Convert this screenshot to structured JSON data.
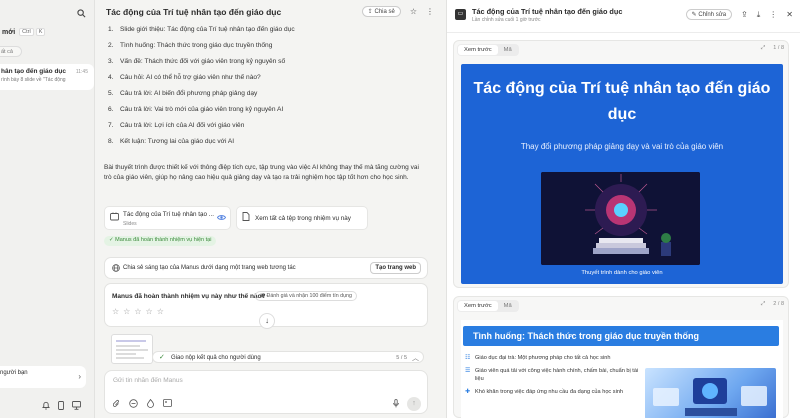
{
  "sidebar": {
    "new_label": "mới",
    "new_shortcut_1": "Ctrl",
    "new_shortcut_2": "K",
    "filter_chip": "ất cả",
    "task": {
      "title": "hân tạo đến giáo dục",
      "time": "11:45",
      "subtitle": "rình bày 8 slide về \"Tác động"
    },
    "share_prompt": "người bạn"
  },
  "chat": {
    "title": "Tác động của Trí tuệ nhân tạo đến giáo dục",
    "share_label": "Chia sẻ",
    "outline": [
      {
        "n": "1.",
        "text": "Slide giới thiệu: Tác động của Trí tuệ nhân tạo đến giáo dục"
      },
      {
        "n": "2.",
        "text": "Tình huống: Thách thức trong giáo dục truyền thống"
      },
      {
        "n": "3.",
        "text": "Vấn đề: Thách thức đối với giáo viên trong kỷ nguyên số"
      },
      {
        "n": "4.",
        "text": "Câu hỏi: AI có thể hỗ trợ giáo viên như thế nào?"
      },
      {
        "n": "5.",
        "text": "Câu trả lời: AI biến đổi phương pháp giảng dạy"
      },
      {
        "n": "6.",
        "text": "Câu trả lời: Vai trò mới của giáo viên trong kỷ nguyên AI"
      },
      {
        "n": "7.",
        "text": "Câu trả lời: Lợi ích của AI đối với giáo viên"
      },
      {
        "n": "8.",
        "text": "Kết luận: Tương lai của giáo dục với AI"
      }
    ],
    "summary": "Bài thuyết trình được thiết kế với thông điệp tích cực, tập trung vào việc AI không thay thế mà tăng cường vai trò của giáo viên, giúp họ nâng cao hiệu quả giảng dạy và tạo ra trải nghiệm học tập tốt hơn cho học sinh.",
    "attachment": {
      "title": "Tác động của Trí tuệ nhân tạo ...",
      "type": "Slides"
    },
    "view_all_files": "Xem tất cả tệp trong nhiệm vụ này",
    "done_badge": "Manus đã hoàn thành nhiệm vụ hiện tại",
    "share_manus": {
      "text": "Chia sẻ sáng tạo của Manus dưới dạng một trang web tương tác",
      "button": "Tạo trang web"
    },
    "rating": {
      "question": "Manus đã hoàn thành nhiệm vụ này như thế nào?",
      "badge": "Đánh giá và nhận 100 điểm tín dụng",
      "stars": "☆☆☆☆☆"
    },
    "progress": {
      "text": "Giao nộp kết quả cho người dùng",
      "count": "5 / 5"
    },
    "input": {
      "placeholder": "Gửi tin nhắn đến Manus",
      "value": ""
    }
  },
  "preview": {
    "title": "Tác động của Trí tuệ nhân tạo đến giáo dục",
    "subtitle": "Lần chỉnh sửa cuối 1 giờ trước",
    "edit_label": "Chỉnh sửa",
    "slides": [
      {
        "tab_preview": "Xem trước",
        "tab_code": "Mã",
        "counter": "1 / 8",
        "title": "Tác động của Trí tuệ nhân tạo đến giáo dục",
        "subtitle": "Thay đổi phương pháp giảng dạy và vai trò của giáo viên",
        "caption": "Thuyết trình dành cho giáo viên"
      },
      {
        "tab_preview": "Xem trước",
        "tab_code": "Mã",
        "counter": "2 / 8",
        "title": "Tình huống: Thách thức trong giáo dục truyền thống",
        "bullets": [
          "Giáo dục đại trà: Một phương pháp cho tất cả học sinh",
          "Giáo viên quá tải với công việc hành chính, chấm bài, chuẩn bị tài liệu",
          "Khó khăn trong việc đáp ứng nhu cầu đa dạng của học sinh"
        ]
      }
    ]
  },
  "colors": {
    "slide1_bg": "#1d64d6",
    "slide2_header": "#2a7de1",
    "done_green": "#3a8a3a"
  }
}
